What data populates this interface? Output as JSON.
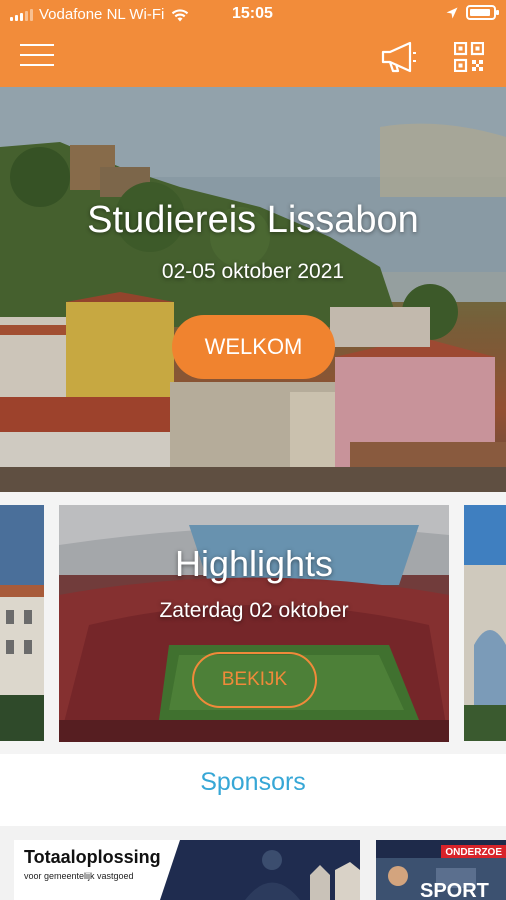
{
  "status_bar": {
    "carrier": "Vodafone NL Wi-Fi",
    "time": "15:05"
  },
  "app_bar": {
    "accent_color": "#f28c3a",
    "icons": [
      "menu-icon",
      "megaphone-icon",
      "qr-code-icon"
    ]
  },
  "hero": {
    "title": "Studiereis Lissabon",
    "date": "02-05 oktober 2021",
    "button_label": "WELKOM"
  },
  "highlights_card": {
    "title": "Highlights",
    "subtitle": "Zaterdag 02 oktober",
    "button_label": "BEKIJK"
  },
  "sponsors": {
    "title": "Sponsors",
    "items": [
      {
        "title": "Totaaloplossing",
        "subtitle": "voor gemeentelijk vastgoed"
      },
      {
        "tag": "ONDERZOE",
        "title": "SPORT"
      }
    ]
  }
}
